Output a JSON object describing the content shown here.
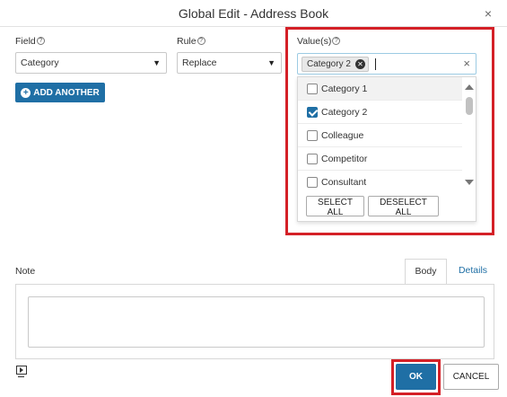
{
  "dialog": {
    "title": "Global Edit - Address Book",
    "close_glyph": "×"
  },
  "form": {
    "field_label": "Field",
    "rule_label": "Rule",
    "values_label": "Value(s)",
    "help_glyph": "?",
    "field_value": "Category",
    "rule_value": "Replace",
    "add_another_label": "ADD ANOTHER",
    "add_icon_glyph": "+"
  },
  "values": {
    "selected_chip": "Category 2",
    "chip_remove_glyph": "✕",
    "clear_glyph": "×",
    "options": [
      {
        "label": "Category 1",
        "checked": false
      },
      {
        "label": "Category 2",
        "checked": true
      },
      {
        "label": "Colleague",
        "checked": false
      },
      {
        "label": "Competitor",
        "checked": false
      },
      {
        "label": "Consultant",
        "checked": false
      }
    ],
    "select_all_label": "SELECT ALL",
    "deselect_all_label": "DESELECT ALL"
  },
  "note": {
    "label": "Note",
    "tabs": [
      "Body",
      "Details"
    ]
  },
  "footer": {
    "ok_label": "OK",
    "cancel_label": "CANCEL"
  },
  "colors": {
    "primary": "#1f6fa5",
    "highlight": "#d42027"
  },
  "icons": {
    "media": "play-screen-icon"
  }
}
